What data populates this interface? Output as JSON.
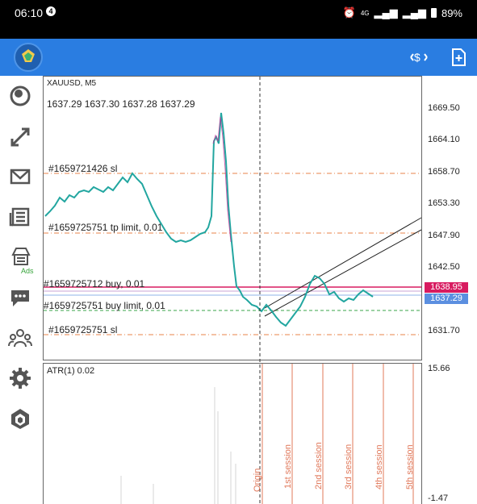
{
  "status_bar": {
    "time": "06:10",
    "notification_count": "4",
    "network": "4G",
    "battery": "89%"
  },
  "chart": {
    "symbol": "XAUUSD, M5",
    "ohlc": "1637.29 1637.30 1637.28 1637.29",
    "price_scale": [
      "1669.50",
      "1664.10",
      "1658.70",
      "1653.30",
      "1647.90",
      "1642.50",
      "1631.70"
    ],
    "price_tags": [
      {
        "text": "1638.95",
        "color": "#d81b60"
      },
      {
        "text": "1637.29",
        "color": "#5b8fe0"
      }
    ],
    "orders": [
      {
        "label": "#1659721426 sl",
        "color": "#e8834a"
      },
      {
        "label": "#1659725751 tp limit, 0.01",
        "color": "#e8834a"
      },
      {
        "label": "#1659725712 buy, 0.01",
        "color": "#d81b60"
      },
      {
        "label": "#1659725751 buy limit, 0.01",
        "color": "#3aa64a"
      },
      {
        "label": "#1659725751 sl",
        "color": "#e8834a"
      }
    ]
  },
  "atr": {
    "label": "ATR(1) 0.02",
    "scale_top": "15.66",
    "scale_bottom": "-1.47",
    "sessions": [
      "Origin",
      "1st session",
      "2nd session",
      "3rd session",
      "4th session",
      "5th session"
    ]
  },
  "icons": {
    "sidebar": [
      "quotes-icon",
      "trade-icon",
      "mail-icon",
      "news-icon",
      "market-icon",
      "chat-icon",
      "community-icon",
      "settings-icon",
      "vps-icon"
    ],
    "appbar": [
      "one-click-trading-icon",
      "new-order-icon"
    ]
  },
  "sidebar_badge": "Ads",
  "colors": {
    "accent": "#2a7de1",
    "candle_up": "#22a6a0",
    "candle_down": "#c0379a"
  }
}
